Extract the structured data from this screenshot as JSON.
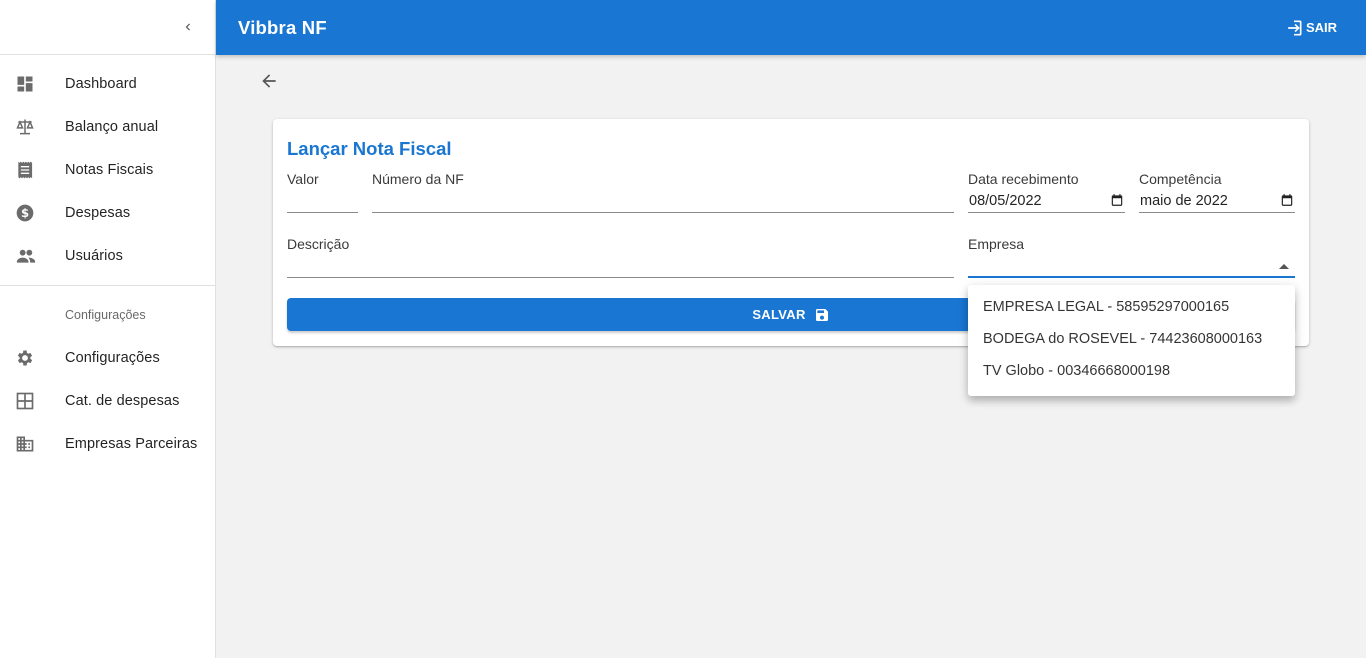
{
  "app": {
    "title": "Vibbra NF",
    "logout_label": "SAIR"
  },
  "sidebar": {
    "items": [
      {
        "label": "Dashboard",
        "icon": "dashboard-icon"
      },
      {
        "label": "Balanço anual",
        "icon": "balance-scale-icon"
      },
      {
        "label": "Notas Fiscais",
        "icon": "receipt-icon"
      },
      {
        "label": "Despesas",
        "icon": "dollar-icon"
      },
      {
        "label": "Usuários",
        "icon": "people-icon"
      }
    ],
    "section_label": "Configurações",
    "config_items": [
      {
        "label": "Configurações",
        "icon": "gear-icon"
      },
      {
        "label": "Cat. de despesas",
        "icon": "grid-icon"
      },
      {
        "label": "Empresas Parceiras",
        "icon": "building-icon"
      }
    ]
  },
  "form": {
    "title": "Lançar Nota Fiscal",
    "valor_label": "Valor",
    "valor_value": "",
    "numero_label": "Número da NF",
    "numero_value": "",
    "data_label": "Data recebimento",
    "data_value": "08/05/2022",
    "competencia_label": "Competência",
    "competencia_value": "maio de 2022",
    "descricao_label": "Descrição",
    "descricao_value": "",
    "empresa_label": "Empresa",
    "empresa_value": "",
    "save_label": "SALVAR"
  },
  "empresa_options": [
    "EMPRESA LEGAL - 58595297000165",
    "BODEGA do ROSEVEL - 74423608000163",
    "TV Globo - 00346668000198"
  ],
  "colors": {
    "primary": "#1976d2",
    "icon_grey": "#6b6b6b",
    "background": "#f2f2f2"
  }
}
